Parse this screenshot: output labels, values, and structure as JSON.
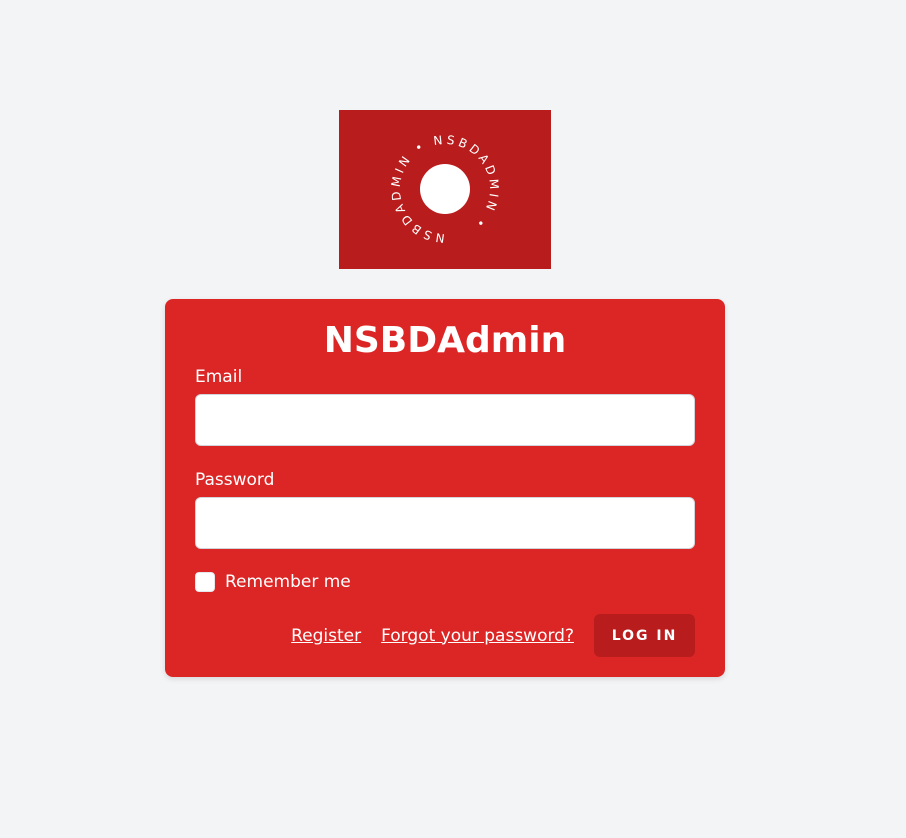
{
  "logo": {
    "ring_text": "NSBDADMIN • NSBDADMIN •",
    "background": "#b91c1c"
  },
  "card": {
    "title": "NSBDAdmin",
    "background": "#dc2626"
  },
  "form": {
    "email_label": "Email",
    "email_value": "",
    "password_label": "Password",
    "password_value": "",
    "remember_label": "Remember me",
    "register_link": "Register",
    "forgot_link": "Forgot your password?",
    "login_button": "LOG IN"
  }
}
